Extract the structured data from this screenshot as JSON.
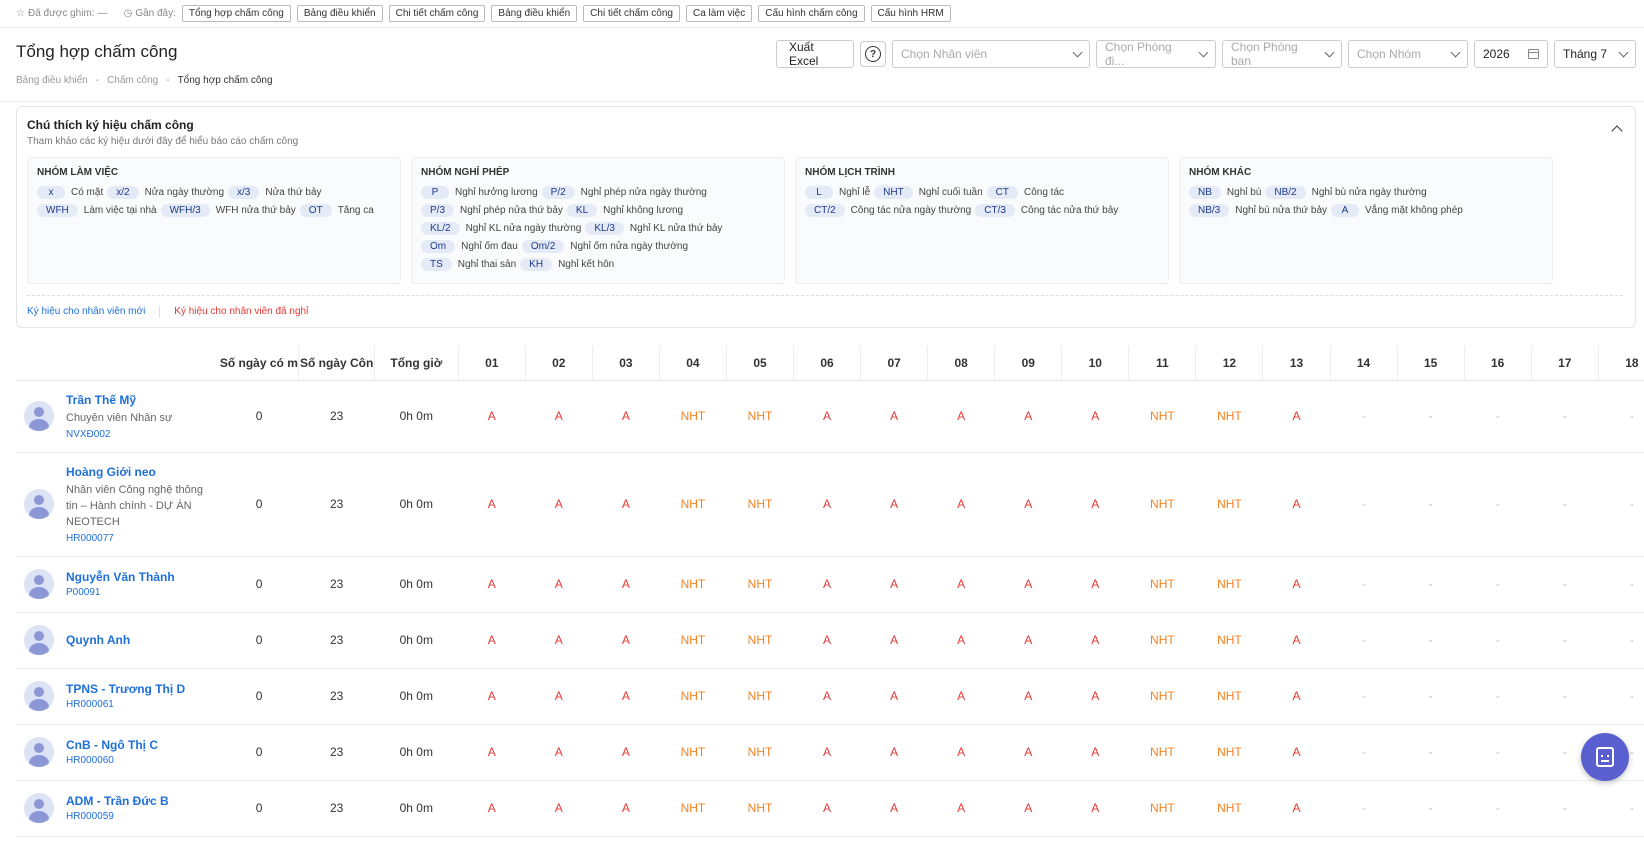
{
  "topbar": {
    "pinned_label": "Đã được ghim:",
    "pinned_value": "—",
    "recent_label": "Gần đây:",
    "recent": [
      "Tổng hợp chấm công",
      "Bảng điều khiển",
      "Chi tiết chấm công",
      "Bảng điều khiển",
      "Chi tiết chấm công",
      "Ca làm việc",
      "Cấu hình chấm công",
      "Cấu hình HRM"
    ]
  },
  "header": {
    "title": "Tổng hợp chấm công",
    "breadcrumb": [
      "Bảng điều khiển",
      "Chấm công",
      "Tổng hợp chấm công"
    ],
    "export_label": "Xuất Excel",
    "filters": {
      "employee": "Chọn Nhân viên",
      "division": "Chọn Phòng đi...",
      "department": "Chọn Phòng ban",
      "group": "Chọn Nhóm",
      "year": "2026",
      "month": "Tháng 7"
    }
  },
  "legend": {
    "title": "Chú thích ký hiệu chấm công",
    "subtitle": "Tham khảo các ký hiệu dưới đây để hiểu báo cáo chấm công",
    "groups": [
      {
        "title": "NHÓM LÀM VIỆC",
        "items": [
          {
            "code": "x",
            "desc": "Có mặt"
          },
          {
            "code": "x/2",
            "desc": "Nửa ngày thường"
          },
          {
            "code": "x/3",
            "desc": "Nửa thứ bảy"
          },
          {
            "code": "WFH",
            "desc": "Làm việc tại nhà"
          },
          {
            "code": "WFH/3",
            "desc": "WFH nửa thứ bảy"
          },
          {
            "code": "OT",
            "desc": "Tăng ca"
          }
        ]
      },
      {
        "title": "NHÓM NGHỈ PHÉP",
        "items": [
          {
            "code": "P",
            "desc": "Nghỉ hưởng lương"
          },
          {
            "code": "P/2",
            "desc": "Nghỉ phép nửa ngày thường"
          },
          {
            "code": "P/3",
            "desc": "Nghỉ phép nửa thứ bảy"
          },
          {
            "code": "KL",
            "desc": "Nghỉ không lương"
          },
          {
            "code": "KL/2",
            "desc": "Nghỉ KL nửa ngày thường"
          },
          {
            "code": "KL/3",
            "desc": "Nghỉ KL nửa thứ bảy"
          },
          {
            "code": "Om",
            "desc": "Nghỉ ốm đau"
          },
          {
            "code": "Om/2",
            "desc": "Nghỉ ốm nửa ngày thường"
          },
          {
            "code": "TS",
            "desc": "Nghỉ thai sản"
          },
          {
            "code": "KH",
            "desc": "Nghỉ kết hôn"
          }
        ]
      },
      {
        "title": "NHÓM LỊCH TRÌNH",
        "items": [
          {
            "code": "L",
            "desc": "Nghỉ lễ"
          },
          {
            "code": "NHT",
            "desc": "Nghỉ cuối tuần"
          },
          {
            "code": "CT",
            "desc": "Công tác"
          },
          {
            "code": "CT/2",
            "desc": "Công tác nửa ngày thường"
          },
          {
            "code": "CT/3",
            "desc": "Công tác nửa thứ bảy"
          }
        ]
      },
      {
        "title": "NHÓM KHÁC",
        "items": [
          {
            "code": "NB",
            "desc": "Nghỉ bù"
          },
          {
            "code": "NB/2",
            "desc": "Nghỉ bù nửa ngày thường"
          },
          {
            "code": "NB/3",
            "desc": "Nghỉ bù nửa thứ bảy"
          },
          {
            "code": "A",
            "desc": "Vắng mặt không phép"
          }
        ]
      }
    ],
    "link_new": "Ký hiệu cho nhân viên mới",
    "link_left": "Ký hiệu cho nhân viên đã nghỉ"
  },
  "table": {
    "headers": [
      "Số ngày có m",
      "Số ngày Côn",
      "Tổng giờ",
      "01",
      "02",
      "03",
      "04",
      "05",
      "06",
      "07",
      "08",
      "09",
      "10",
      "11",
      "12",
      "13",
      "14",
      "15",
      "16",
      "17",
      "18"
    ],
    "rows": [
      {
        "name": "Trần Thế Mỹ",
        "position": "Chuyên viên Nhân sự",
        "code": "NVXĐ002",
        "present": "0",
        "workdays": "23",
        "hours": "0h 0m",
        "days": [
          "A",
          "A",
          "A",
          "NHT",
          "NHT",
          "A",
          "A",
          "A",
          "A",
          "A",
          "NHT",
          "NHT",
          "A",
          "-",
          "-",
          "-",
          "-",
          "-"
        ]
      },
      {
        "name": "Hoàng Giới neo",
        "position": "Nhân viên Công nghệ thông tin – Hành chính - DỰ ÁN NEOTECH",
        "code": "HR000077",
        "present": "0",
        "workdays": "23",
        "hours": "0h 0m",
        "days": [
          "A",
          "A",
          "A",
          "NHT",
          "NHT",
          "A",
          "A",
          "A",
          "A",
          "A",
          "NHT",
          "NHT",
          "A",
          "-",
          "-",
          "-",
          "-",
          "-"
        ]
      },
      {
        "name": "Nguyễn Văn Thành",
        "position": "",
        "code": "P00091",
        "present": "0",
        "workdays": "23",
        "hours": "0h 0m",
        "days": [
          "A",
          "A",
          "A",
          "NHT",
          "NHT",
          "A",
          "A",
          "A",
          "A",
          "A",
          "NHT",
          "NHT",
          "A",
          "-",
          "-",
          "-",
          "-",
          "-"
        ]
      },
      {
        "name": "Quynh Anh",
        "position": "",
        "code": "",
        "present": "0",
        "workdays": "23",
        "hours": "0h 0m",
        "days": [
          "A",
          "A",
          "A",
          "NHT",
          "NHT",
          "A",
          "A",
          "A",
          "A",
          "A",
          "NHT",
          "NHT",
          "A",
          "-",
          "-",
          "-",
          "-",
          "-"
        ]
      },
      {
        "name": "TPNS - Trương Thị D",
        "position": "",
        "code": "HR000061",
        "present": "0",
        "workdays": "23",
        "hours": "0h 0m",
        "days": [
          "A",
          "A",
          "A",
          "NHT",
          "NHT",
          "A",
          "A",
          "A",
          "A",
          "A",
          "NHT",
          "NHT",
          "A",
          "-",
          "-",
          "-",
          "-",
          "-"
        ]
      },
      {
        "name": "CnB - Ngô Thị C",
        "position": "",
        "code": "HR000060",
        "present": "0",
        "workdays": "23",
        "hours": "0h 0m",
        "days": [
          "A",
          "A",
          "A",
          "NHT",
          "NHT",
          "A",
          "A",
          "A",
          "A",
          "A",
          "NHT",
          "NHT",
          "A",
          "-",
          "-",
          "-",
          "-",
          "-"
        ]
      },
      {
        "name": "ADM - Trần Đức B",
        "position": "",
        "code": "HR000059",
        "present": "0",
        "workdays": "23",
        "hours": "0h 0m",
        "days": [
          "A",
          "A",
          "A",
          "NHT",
          "NHT",
          "A",
          "A",
          "A",
          "A",
          "A",
          "NHT",
          "NHT",
          "A",
          "-",
          "-",
          "-",
          "-",
          "-"
        ]
      }
    ]
  },
  "colors": {
    "absent": "#e53935",
    "weekend": "#f58220",
    "link": "#1e6fd9",
    "fab": "#5a5fcf"
  },
  "icons": {
    "pin": "star-icon",
    "recent": "clock-icon",
    "help": "question-circle-icon",
    "fab": "assistant-icon"
  }
}
